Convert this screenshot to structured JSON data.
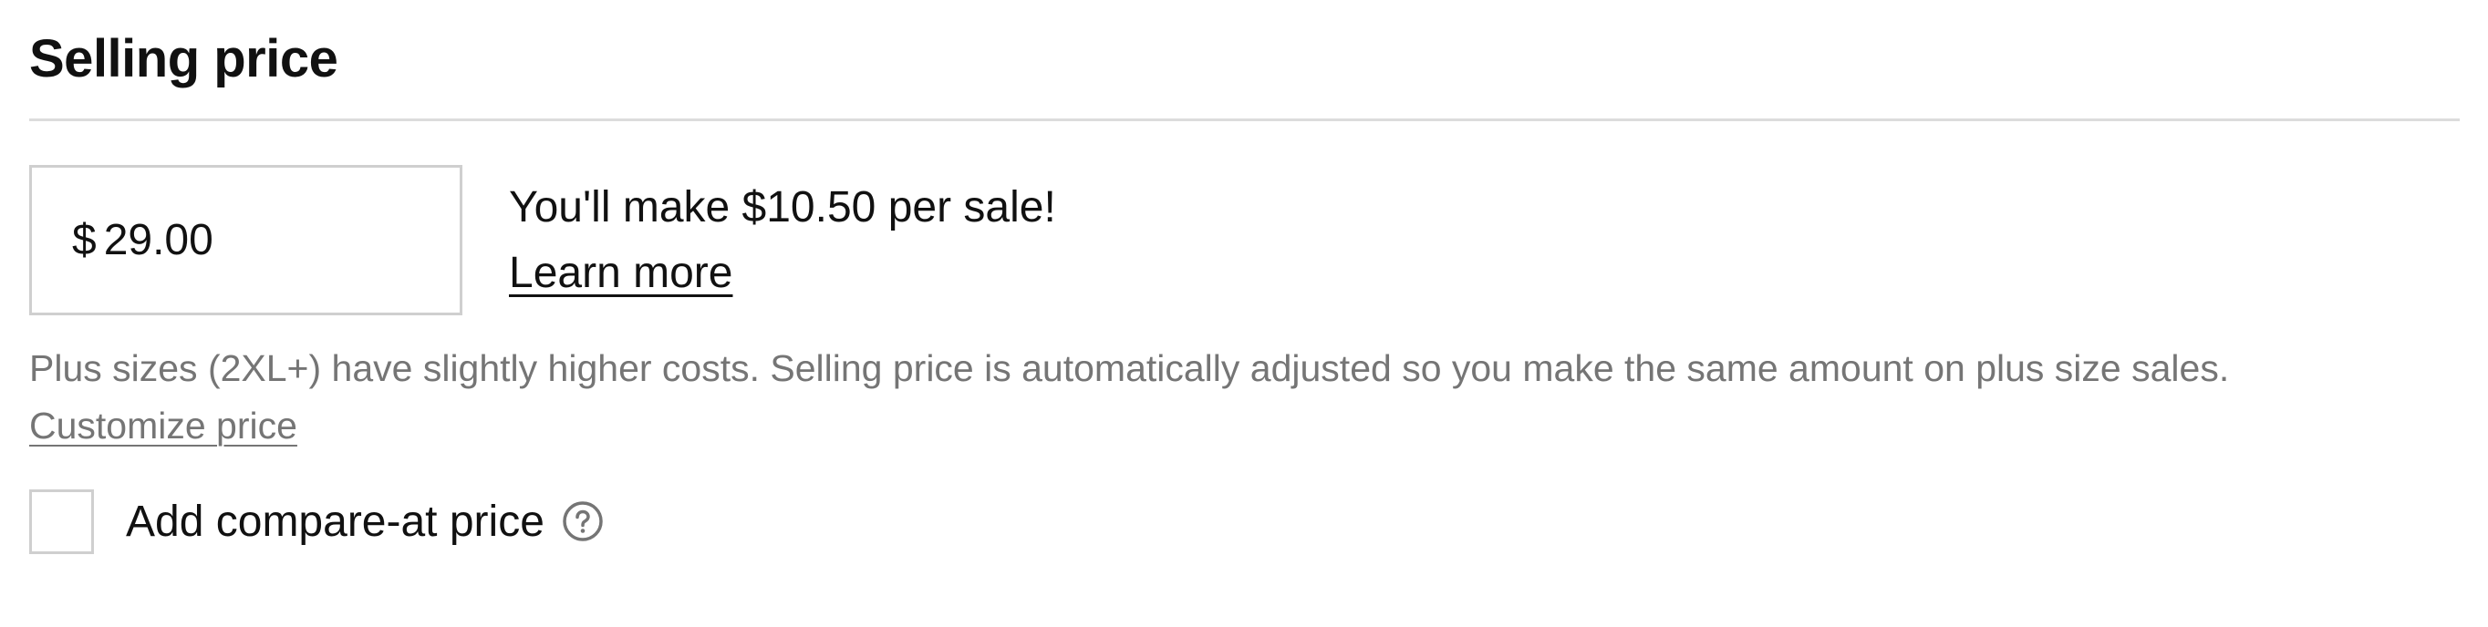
{
  "section": {
    "title": "Selling price"
  },
  "price_input": {
    "currency_symbol": "$",
    "value": "29.00"
  },
  "earnings": {
    "message": "You'll make $10.50 per sale!",
    "learn_more_label": "Learn more"
  },
  "plus_size_note": {
    "text": "Plus sizes (2XL+) have slightly higher costs. Selling price is automatically adjusted so you make the same amount on plus size sales.",
    "customize_label": "Customize price"
  },
  "compare_at": {
    "label": "Add compare-at price",
    "checked": false,
    "help_icon": "question-circle-icon"
  },
  "colors": {
    "text_primary": "#111111",
    "text_secondary": "#757575",
    "border": "#cfcfcf",
    "divider": "#dcdcdc"
  }
}
